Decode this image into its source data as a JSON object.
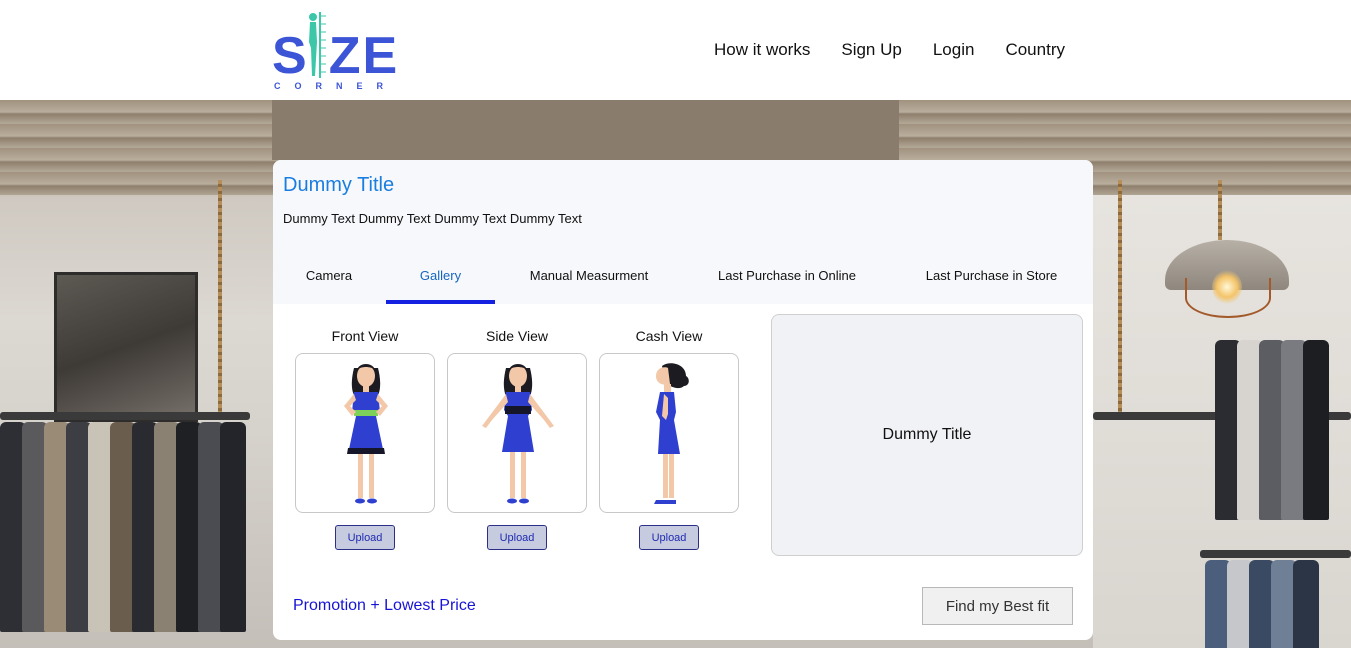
{
  "header": {
    "logo_text": "SIZE",
    "logo_subtext": "CORNER",
    "nav": [
      {
        "label": "How it works"
      },
      {
        "label": "Sign Up"
      },
      {
        "label": "Login"
      },
      {
        "label": "Country"
      }
    ]
  },
  "card": {
    "title": "Dummy Title",
    "description": "Dummy Text Dummy Text Dummy Text Dummy Text",
    "tabs": [
      {
        "label": "Camera",
        "active": false
      },
      {
        "label": "Gallery",
        "active": true
      },
      {
        "label": "Manual Measurment",
        "active": false
      },
      {
        "label": "Last Purchase in Online",
        "active": false
      },
      {
        "label": "Last Purchase in Store",
        "active": false
      }
    ],
    "views": [
      {
        "label": "Front View",
        "upload_label": "Upload"
      },
      {
        "label": "Side View",
        "upload_label": "Upload"
      },
      {
        "label": "Cash View",
        "upload_label": "Upload"
      }
    ],
    "preview_title": "Dummy Title",
    "promo_text": "Promotion + Lowest Price",
    "best_fit_label": "Find my Best fit"
  },
  "colors": {
    "brand": "#3c55d6",
    "logo_accent": "#3cc7a8",
    "title_blue": "#1a7ee0",
    "tab_indicator": "#1521e0",
    "promo_blue": "#1614d6",
    "dress_blue": "#2f3fd0"
  }
}
